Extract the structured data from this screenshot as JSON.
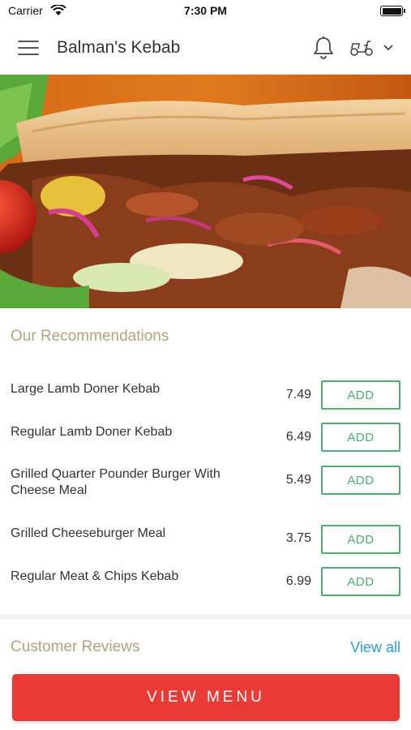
{
  "status_bar": {
    "carrier": "Carrier",
    "time": "7:30 PM"
  },
  "header": {
    "title": "Balman's Kebab",
    "icons": [
      "menu-icon",
      "bell-icon",
      "scooter-icon",
      "chevron-down-icon"
    ]
  },
  "recommendations": {
    "title": "Our Recommendations",
    "add_label": "ADD",
    "items": [
      {
        "name": "Large Lamb Doner Kebab",
        "price": "7.49"
      },
      {
        "name": "Regular Lamb Doner Kebab",
        "price": "6.49"
      },
      {
        "name": "Grilled Quarter Pounder Burger With Cheese Meal",
        "price": "5.49"
      },
      {
        "name": "Grilled Cheeseburger Meal",
        "price": "3.75"
      },
      {
        "name": "Regular Meat & Chips Kebab",
        "price": "6.99"
      }
    ]
  },
  "reviews": {
    "title": "Customer Reviews",
    "view_all": "View all"
  },
  "footer": {
    "view_menu": "VIEW MENU"
  },
  "colors": {
    "accent_red": "#e93a36",
    "add_green": "#4caf6d",
    "heading_tan": "#b3a37e",
    "link_blue": "#2a9fd6"
  }
}
